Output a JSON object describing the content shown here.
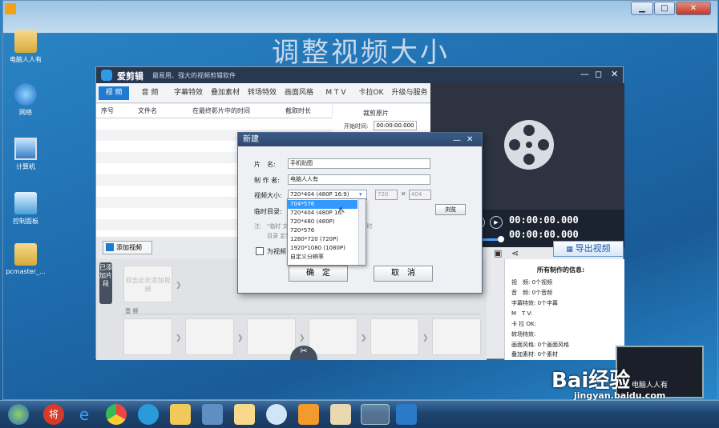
{
  "video_overlay_title": "调整视频大小",
  "desktop_icons": [
    {
      "label": "电脑人人有"
    },
    {
      "label": "网络"
    },
    {
      "label": "计算机"
    },
    {
      "label": "控制面板"
    },
    {
      "label": "pcmaster_..."
    }
  ],
  "app": {
    "name": "爱剪辑",
    "slogan": "最易用、强大的视频剪辑软件",
    "tabs": [
      "视 频",
      "音 频",
      "字幕特效",
      "叠加素材",
      "转场特效",
      "画面风格",
      "M T V",
      "卡拉OK",
      "升级与服务"
    ],
    "list_columns": [
      "序号",
      "文件名",
      "在最终影片中的时间",
      "截取时长"
    ],
    "clip_panel": {
      "title": "裁剪原片",
      "start_label": "开始时间:",
      "start_value": "00:00:00.000"
    },
    "timecode_top": "00:00:00.000",
    "timecode_bottom": "00:00:00.000",
    "add_video_label": "添加视频",
    "export_label": "导出视频",
    "added_clips_label": "已添加片段",
    "slot_hint": "双击此处添加视频",
    "audio_label": "音 频",
    "info": {
      "title": "所有制作的信息:",
      "rows": [
        {
          "k": "视　频:",
          "v": "0个视频"
        },
        {
          "k": "音　频:",
          "v": "0个音频"
        },
        {
          "k": "字幕特效:",
          "v": "0个字幕"
        },
        {
          "k": "M　T V:",
          "v": ""
        },
        {
          "k": "卡 拉 OK:",
          "v": ""
        },
        {
          "k": "转场特效:",
          "v": ""
        },
        {
          "k": "画面风格:",
          "v": "0个画面风格"
        },
        {
          "k": "叠加素材:",
          "v": "0个素材"
        }
      ]
    }
  },
  "dialog": {
    "title": "新建",
    "name_label": "片　名:",
    "name_value": "手机贴图",
    "author_label": "制 作 者:",
    "author_value": "电脑人人有",
    "size_label": "视频大小:",
    "size_value": "720*404 (480P 16:9)",
    "width_value": "720",
    "height_value": "404",
    "temp_label": "临时目录:",
    "browse_label": "浏览",
    "note_prefix": "注:",
    "note_line1": "\"临时 文件摆放位置。如果软件默认的临时",
    "note_line2": "目录 定到更大的磁盘空间处。",
    "checkbox_label": "为视频自",
    "ok_label": "确　定",
    "cancel_label": "取　消",
    "size_options": [
      "704*576",
      "720*404 (480P 16:",
      "720*480 (480P)",
      "720*576",
      "1280*720 (720P)",
      "1920*1080 (1080P)",
      "自定义分辨率"
    ],
    "selected_option": 0
  },
  "watermark": {
    "brand": "Bai经验",
    "url": "jingyan.baidu.com",
    "thumb_text": "电脑人人有"
  },
  "colors": {
    "accent": "#1e7bd1",
    "dialog_title": "#2e4a70",
    "app_title": "#283850"
  }
}
